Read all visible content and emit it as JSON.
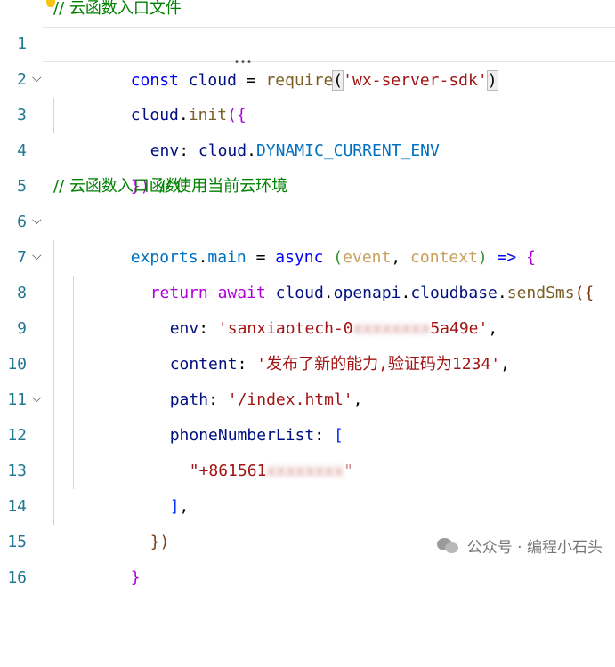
{
  "lines": [
    {
      "n": "1",
      "comment": "// 云函数入口文件"
    },
    {
      "n": "2",
      "t": [
        "const",
        " cloud ",
        "=",
        " ",
        "require",
        "(",
        "'wx-server-sdk'",
        ")"
      ]
    },
    {
      "n": "3",
      "t": [
        "cloud",
        ".",
        "init",
        "({"
      ]
    },
    {
      "n": "4",
      "t": [
        "env",
        ": ",
        "cloud",
        ".",
        "DYNAMIC_CURRENT_ENV"
      ]
    },
    {
      "n": "5",
      "t": [
        "})",
        " ",
        "// 使用当前云环境"
      ]
    },
    {
      "n": "6",
      "comment": "// 云函数入口函数"
    },
    {
      "n": "7",
      "t": [
        "exports",
        ".",
        "main",
        " = ",
        "async",
        " (",
        "event",
        ", ",
        "context",
        ") ",
        "=>",
        " ",
        "{"
      ]
    },
    {
      "n": "8",
      "t": [
        "return",
        " ",
        "await",
        " ",
        "cloud",
        ".",
        "openapi",
        ".",
        "cloudbase",
        ".",
        "sendSms",
        "({"
      ]
    },
    {
      "n": "9",
      "t": [
        "env",
        ": ",
        "'sanxiaotech-0",
        "xxxxxxxx",
        "5a49e'",
        ","
      ]
    },
    {
      "n": "10",
      "t": [
        "content",
        ": ",
        "'发布了新的能力,验证码为1234'",
        ","
      ]
    },
    {
      "n": "11",
      "t": [
        "path",
        ": ",
        "'/index.html'",
        ","
      ]
    },
    {
      "n": "12",
      "t": [
        "phoneNumberList",
        ": ",
        "["
      ]
    },
    {
      "n": "13",
      "t": [
        "\"+861561",
        "xxxxxxxx",
        "\""
      ]
    },
    {
      "n": "14",
      "t": [
        "]",
        ","
      ]
    },
    {
      "n": "15",
      "t": [
        "})"
      ]
    },
    {
      "n": "16",
      "t": [
        "}"
      ]
    }
  ],
  "watermark": {
    "text": "公众号 · 编程小石头",
    "icon": "wechat-icon"
  }
}
